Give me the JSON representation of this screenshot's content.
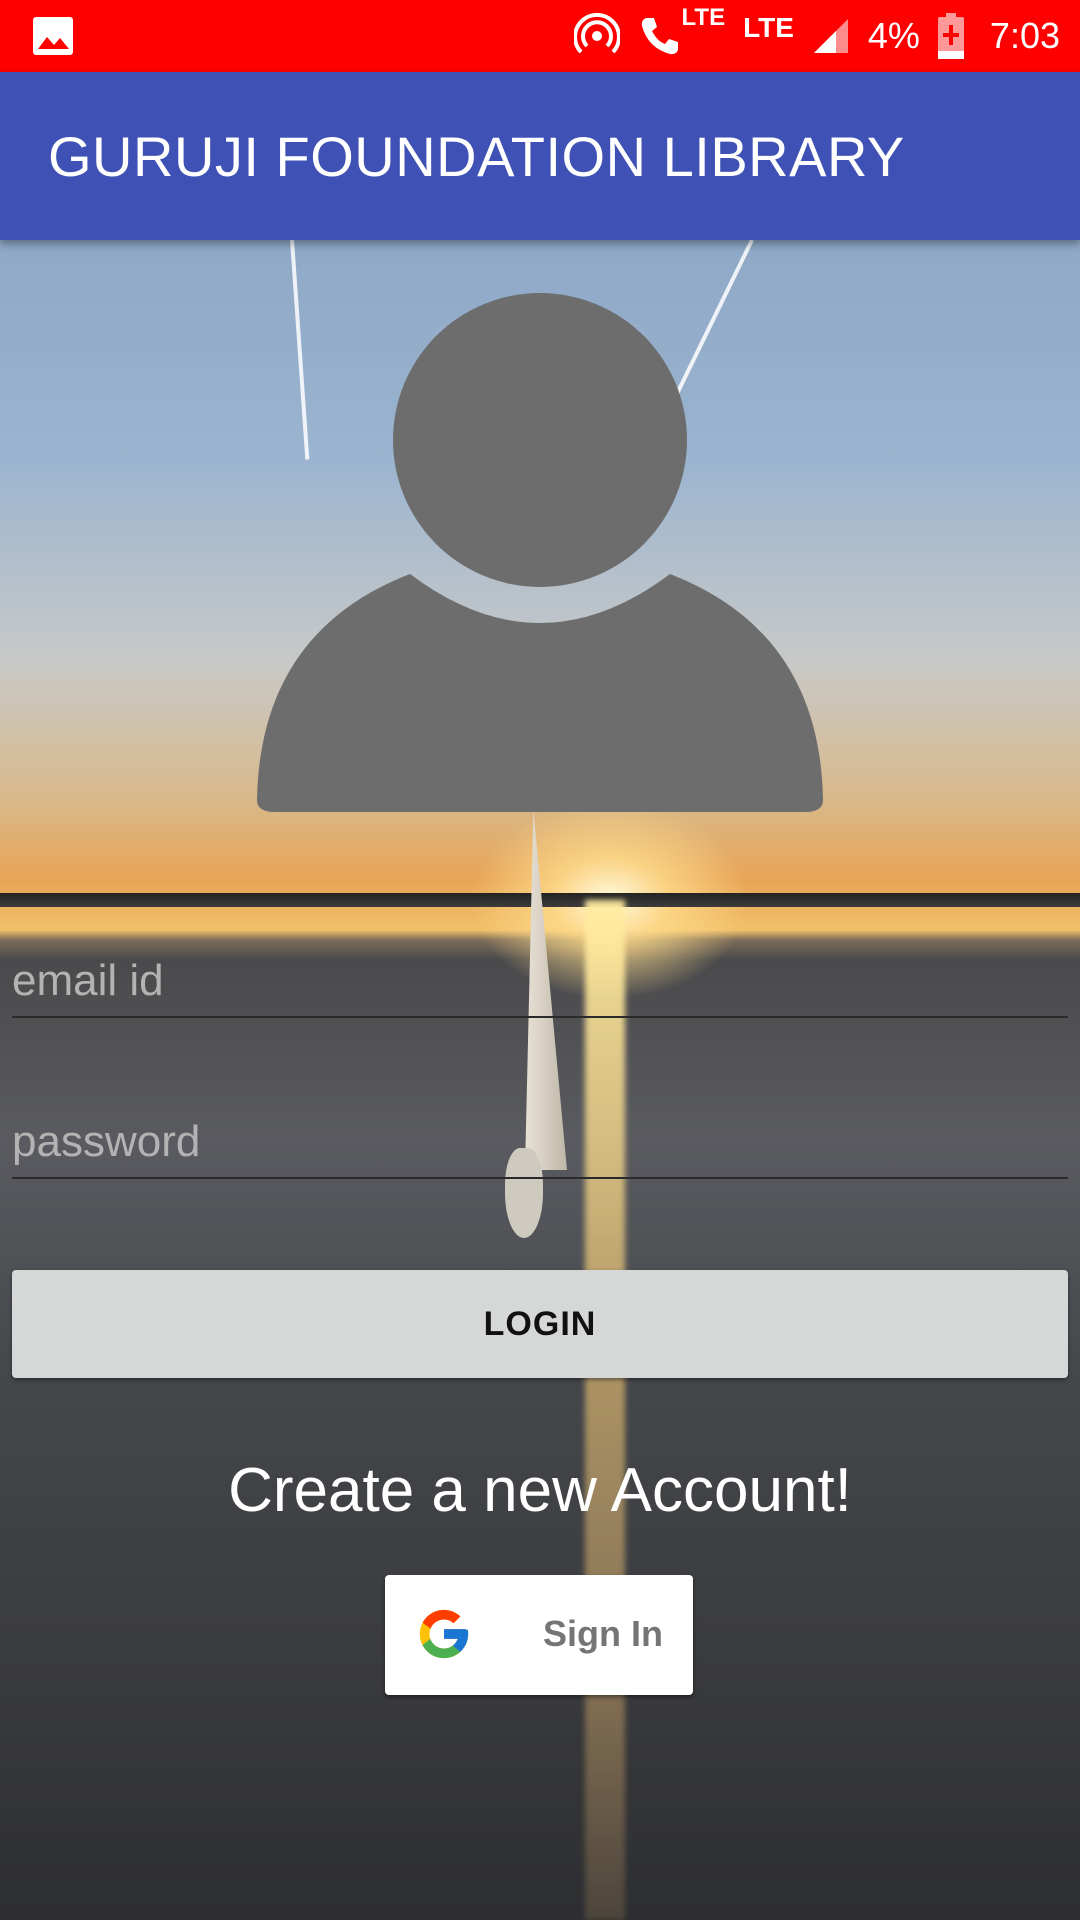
{
  "status_bar": {
    "battery_percent": "4%",
    "time": "7:03",
    "network_label_1": "LTE",
    "network_label_2": "LTE",
    "background_color": "#ff0000"
  },
  "app_bar": {
    "title": "GURUJI FOUNDATION LIBRARY",
    "background_color": "#3f51b5"
  },
  "form": {
    "email_placeholder": "email id",
    "password_placeholder": "password",
    "login_label": "LOGIN"
  },
  "create_account_text": "Create a new Account!",
  "google_sign_in": {
    "label": "Sign In"
  },
  "icons": {
    "status_left": "image-notification-icon",
    "hotspot": "hotspot-icon",
    "call": "phone-call-icon",
    "signal": "signal-icon",
    "battery": "battery-charging-icon",
    "avatar": "person-avatar-icon",
    "google": "google-logo-icon"
  }
}
